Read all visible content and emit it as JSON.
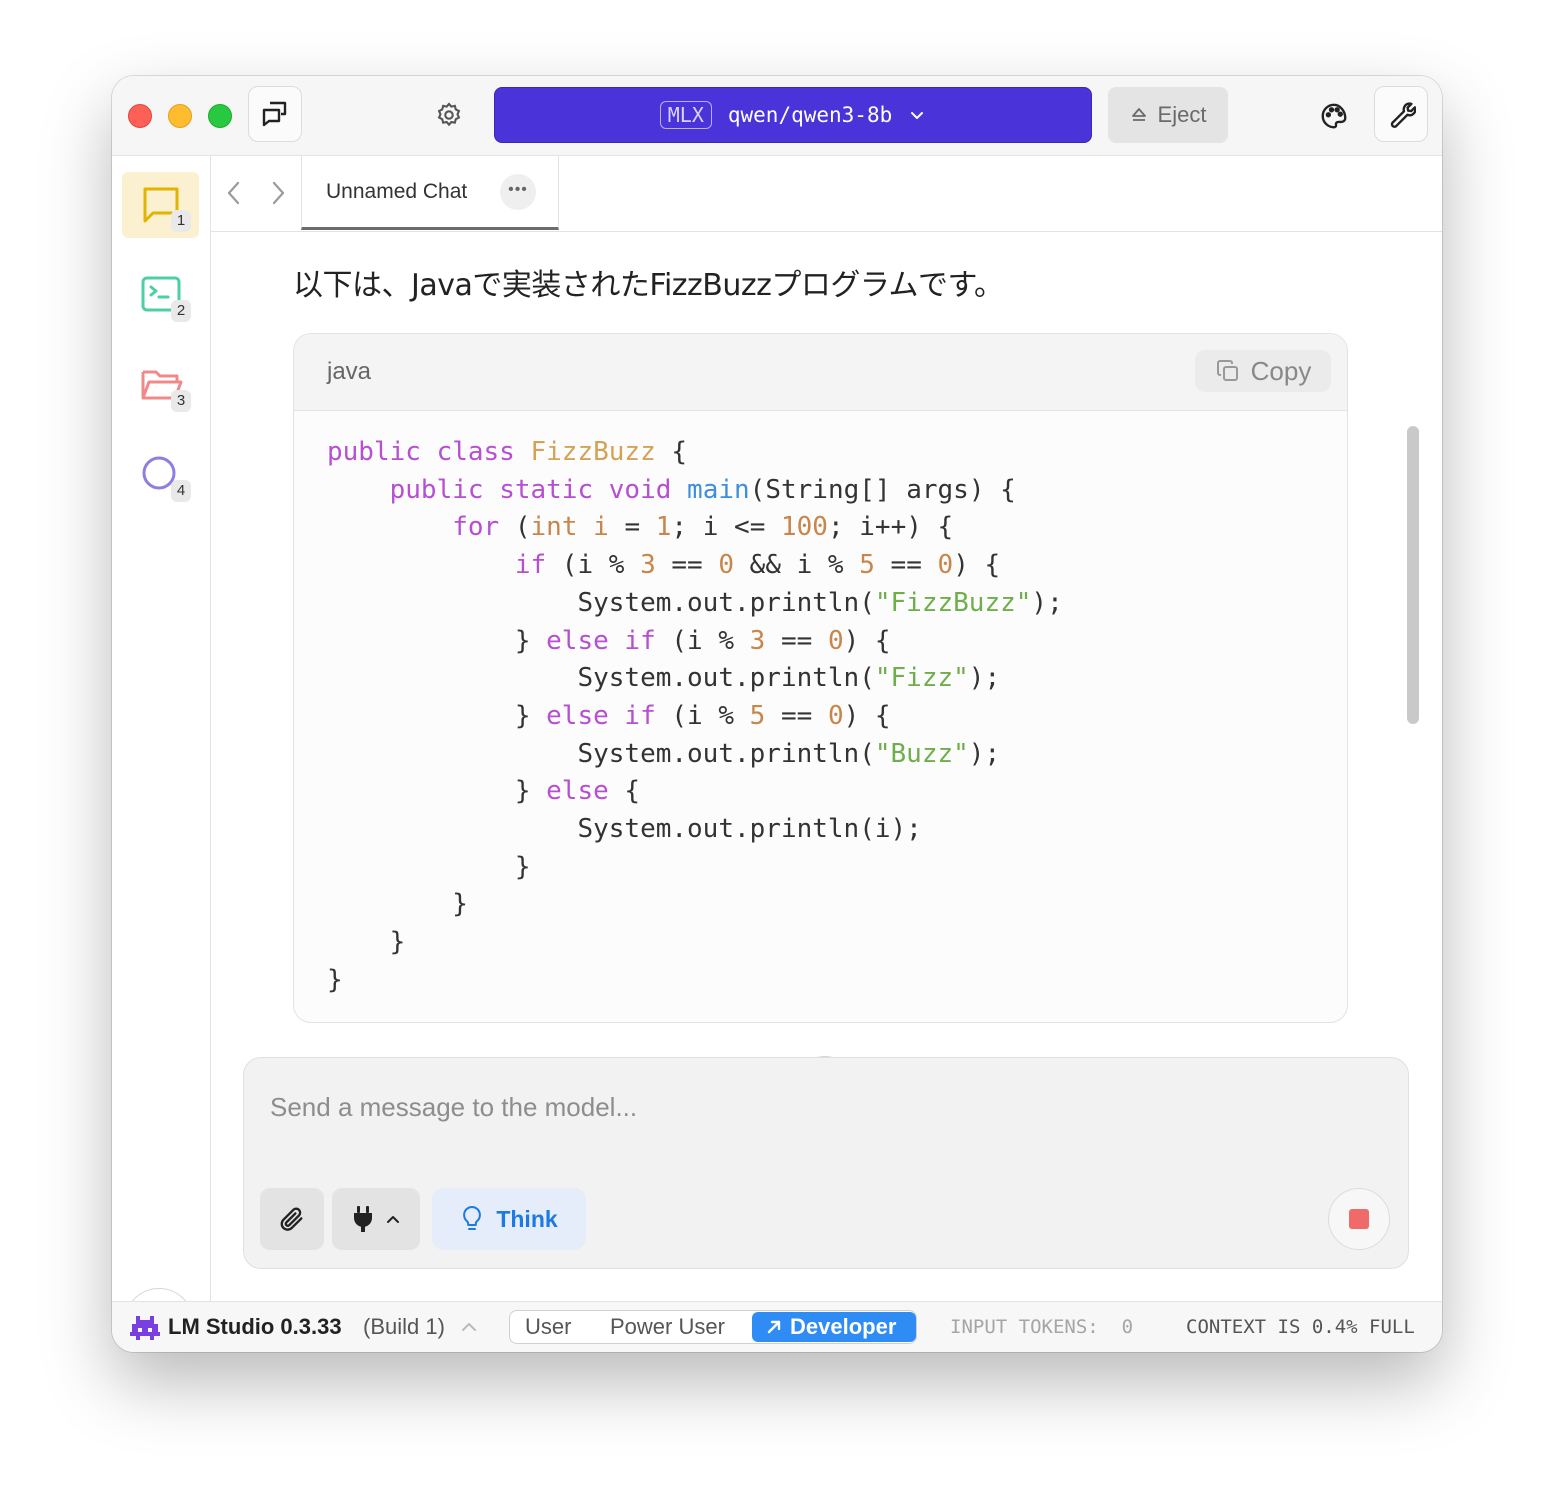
{
  "titlebar": {
    "model_badge": "MLX",
    "model_name": "qwen/qwen3-8b",
    "eject_label": "Eject"
  },
  "sidebar": {
    "items": [
      {
        "num": "1",
        "icon": "chat-bubble-icon",
        "color": "#e0b400",
        "active": true
      },
      {
        "num": "2",
        "icon": "terminal-icon",
        "color": "#4ccfa4",
        "active": false
      },
      {
        "num": "3",
        "icon": "folder-icon",
        "color": "#f08a8a",
        "active": false
      },
      {
        "num": "4",
        "icon": "search-icon",
        "color": "#8d7fe0",
        "active": false
      }
    ]
  },
  "tab": {
    "title": "Unnamed Chat",
    "more_label": "•••"
  },
  "message": {
    "text": "以下は、Javaで実装されたFizzBuzzプログラムです。"
  },
  "code": {
    "language": "java",
    "copy_label": "Copy"
  },
  "composer": {
    "placeholder": "Send a message to the model...",
    "think_label": "Think"
  },
  "status": {
    "app_name": "LM Studio 0.3.33",
    "build": "(Build 1)",
    "modes": [
      "User",
      "Power User",
      "Developer"
    ],
    "active_mode": "Developer",
    "tokens_label": "INPUT TOKENS:",
    "tokens_value": "0",
    "context": "CONTEXT IS 0.4% FULL"
  },
  "colors": {
    "model_select_bg": "#4a34d9",
    "developer_bg": "#2f8cf4",
    "think_text": "#1d7ae0",
    "stop": "#f06a6a"
  }
}
